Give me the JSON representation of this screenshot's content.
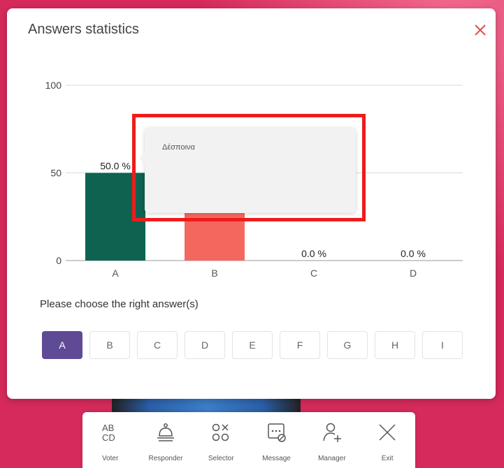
{
  "dialog": {
    "title": "Answers statistics",
    "close_icon": "close-icon"
  },
  "chart_data": {
    "type": "bar",
    "categories": [
      "A",
      "B",
      "C",
      "D"
    ],
    "values": [
      50.0,
      50.0,
      0.0,
      0.0
    ],
    "value_labels": [
      "50.0 %",
      "",
      "0.0 %",
      "0.0 %"
    ],
    "colors": [
      "#0e6350",
      "#f4675f",
      "#0e6350",
      "#0e6350"
    ],
    "yticks": [
      "0",
      "50",
      "100"
    ],
    "ylim": [
      0,
      100
    ],
    "grid": true
  },
  "tooltip": {
    "text": "Δέσποινα"
  },
  "prompt": "Please choose the right answer(s)",
  "choices": [
    "A",
    "B",
    "C",
    "D",
    "E",
    "F",
    "G",
    "H",
    "I"
  ],
  "selected_choice": "A",
  "toolbar": [
    {
      "label": "Voter",
      "icon": "abcd-icon"
    },
    {
      "label": "Responder",
      "icon": "bell-icon"
    },
    {
      "label": "Selector",
      "icon": "selector-icon"
    },
    {
      "label": "Message",
      "icon": "message-icon"
    },
    {
      "label": "Manager",
      "icon": "add-user-icon"
    },
    {
      "label": "Exit",
      "icon": "close-icon"
    }
  ],
  "colors": {
    "accent": "#5f4a96",
    "background": "#d62a5c",
    "highlight": "#ee1c1c"
  }
}
